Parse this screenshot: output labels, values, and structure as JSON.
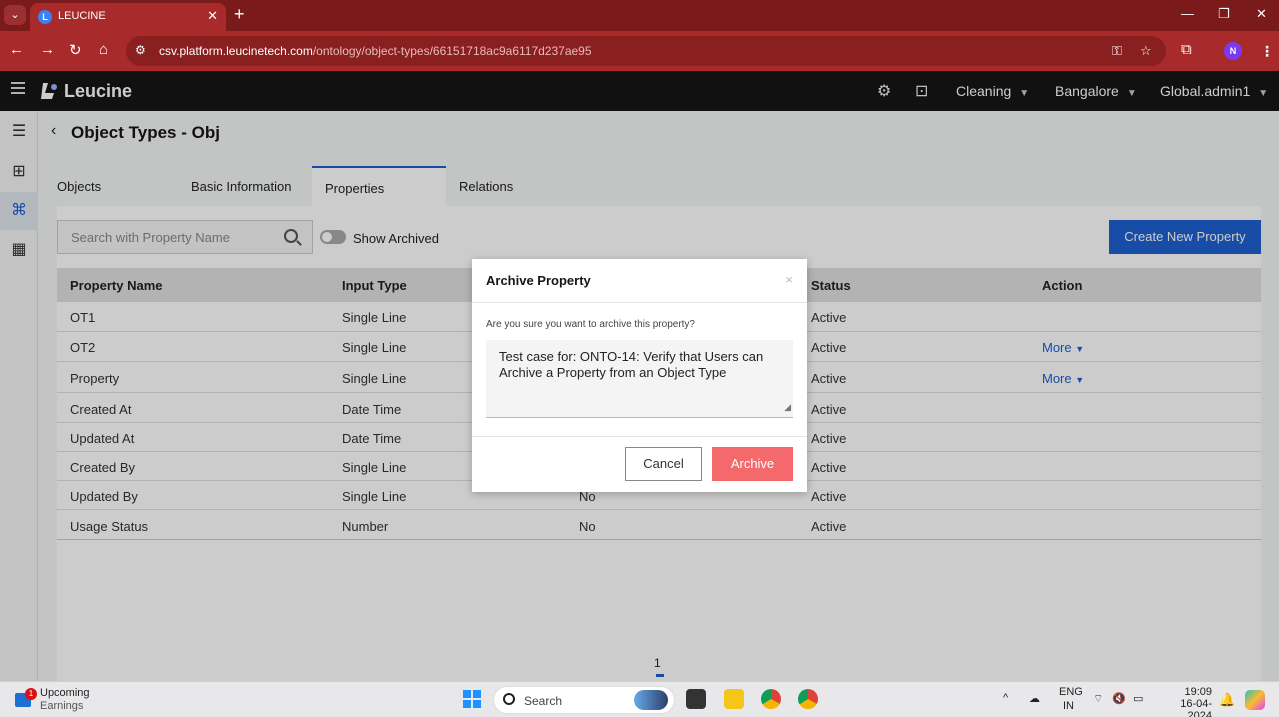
{
  "browser": {
    "tab_title": "LEUCINE",
    "url_host": "csv.platform.leucinetech.com",
    "url_path": "/ontology/object-types/66151718ac9a6117d237ae95",
    "profile_initial": "N"
  },
  "header": {
    "brand": "Leucine",
    "facility": "Cleaning",
    "site": "Bangalore",
    "user": "Global.admin1"
  },
  "page": {
    "title": "Object Types - Obj",
    "tabs": [
      {
        "label": "Objects"
      },
      {
        "label": "Basic Information"
      },
      {
        "label": "Properties"
      },
      {
        "label": "Relations"
      }
    ],
    "search_placeholder": "Search with Property Name",
    "show_archived_label": "Show Archived",
    "show_archived": false,
    "create_button": "Create New Property"
  },
  "table": {
    "columns": [
      "Property Name",
      "Input Type",
      "Status",
      "Action"
    ],
    "rows": [
      {
        "name": "OT1",
        "input_type": "Single Line",
        "mandatory": "",
        "status": "Active",
        "action": ""
      },
      {
        "name": "OT2",
        "input_type": "Single Line",
        "mandatory": "",
        "status": "Active",
        "action": "More"
      },
      {
        "name": "Property",
        "input_type": "Single Line",
        "mandatory": "",
        "status": "Active",
        "action": "More"
      },
      {
        "name": "Created At",
        "input_type": "Date Time",
        "mandatory": "",
        "status": "Active",
        "action": ""
      },
      {
        "name": "Updated At",
        "input_type": "Date Time",
        "mandatory": "",
        "status": "Active",
        "action": ""
      },
      {
        "name": "Created By",
        "input_type": "Single Line",
        "mandatory": "",
        "status": "Active",
        "action": ""
      },
      {
        "name": "Updated By",
        "input_type": "Single Line",
        "mandatory": "No",
        "status": "Active",
        "action": ""
      },
      {
        "name": "Usage Status",
        "input_type": "Number",
        "mandatory": "No",
        "status": "Active",
        "action": ""
      }
    ]
  },
  "pagination": {
    "current": "1"
  },
  "modal": {
    "title": "Archive Property",
    "close": "×",
    "question": "Are you sure you want to archive this property?",
    "reason": "Test case for: ONTO-14: Verify that Users can Archive a Property from an Object Type",
    "cancel_label": "Cancel",
    "archive_label": "Archive"
  },
  "taskbar": {
    "widget_title": "Upcoming",
    "widget_subtitle": "Earnings",
    "widget_badge": "1",
    "search_label": "Search",
    "lang_line1": "ENG",
    "lang_line2": "IN",
    "time": "19:09",
    "date": "16-04-2024"
  },
  "colors": {
    "primary": "#1d5fd1",
    "archive": "#f4696b",
    "browser_chrome": "#a92a2a",
    "app_header": "#161616"
  }
}
